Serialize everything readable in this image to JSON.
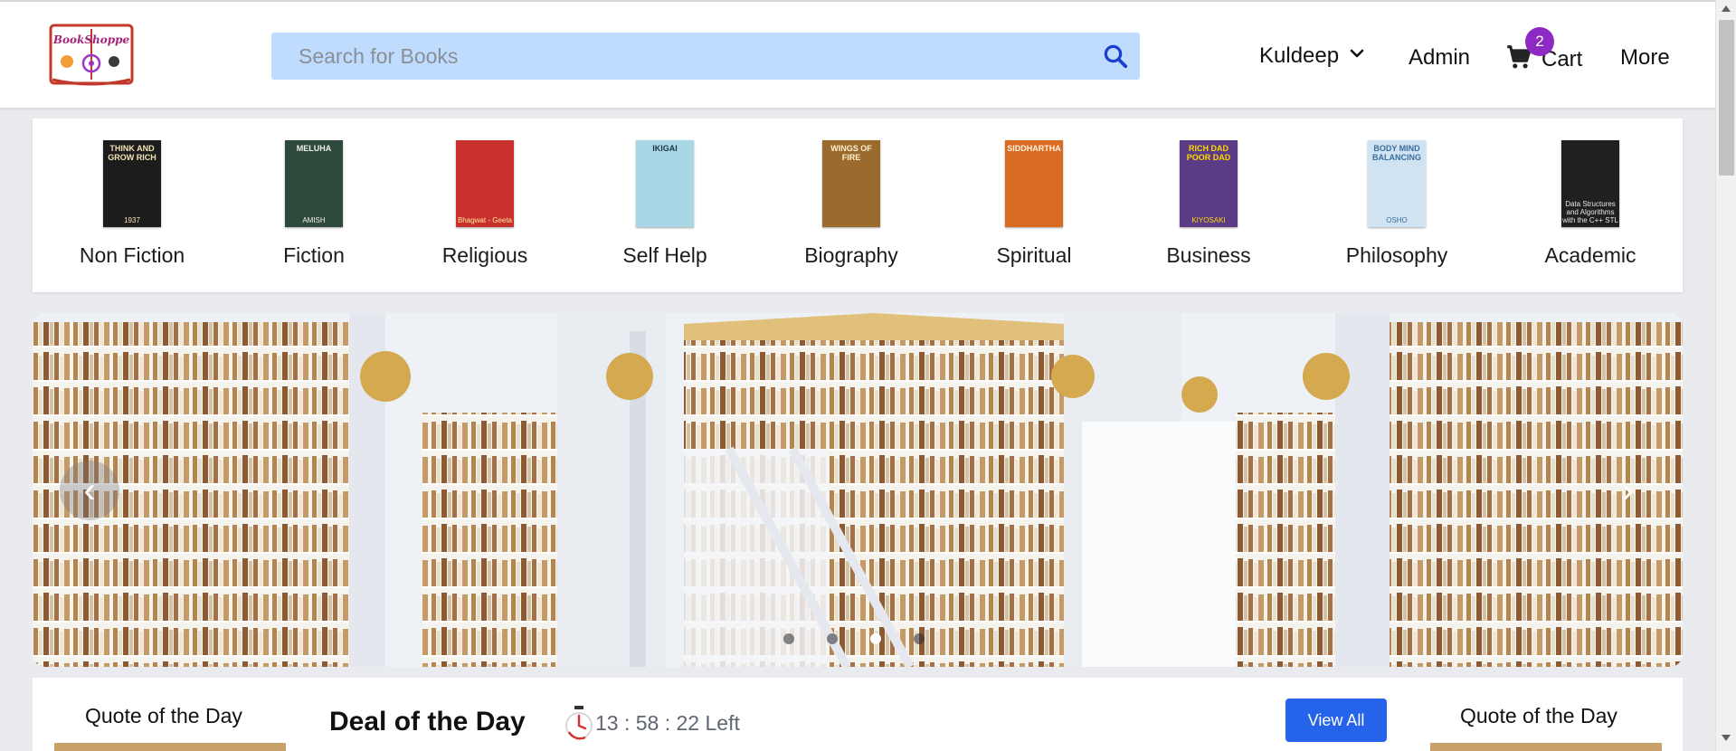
{
  "brand": {
    "logo_text": "BookShoppe"
  },
  "search": {
    "placeholder": "Search for Books",
    "value": ""
  },
  "nav": {
    "user": "Kuldeep",
    "admin": "Admin",
    "cart_label": "Cart",
    "cart_count": "2",
    "more": "More"
  },
  "categories": [
    {
      "label": "Non Fiction",
      "cover_title": "THINK AND GROW RICH",
      "cover_sub": "1937",
      "cover_color": "#1c1c1c",
      "cover_text_color": "#f2e2b5"
    },
    {
      "label": "Fiction",
      "cover_title": "MELUHA",
      "cover_sub": "AMISH",
      "cover_color": "#2e4a3c",
      "cover_text_color": "#f0f0e6"
    },
    {
      "label": "Religious",
      "cover_title": "",
      "cover_sub": "Bhagwat - Geeta",
      "cover_color": "#c8302b",
      "cover_text_color": "#ffe8a0"
    },
    {
      "label": "Self Help",
      "cover_title": "IKIGAI",
      "cover_sub": "",
      "cover_color": "#a8d7e6",
      "cover_text_color": "#1d3440"
    },
    {
      "label": "Biography",
      "cover_title": "WINGS OF FIRE",
      "cover_sub": "",
      "cover_color": "#9b6b2d",
      "cover_text_color": "#fff1cf"
    },
    {
      "label": "Spiritual",
      "cover_title": "SIDDHARTHA",
      "cover_sub": "",
      "cover_color": "#d96c22",
      "cover_text_color": "#fff4e0"
    },
    {
      "label": "Business",
      "cover_title": "RICH DAD POOR DAD",
      "cover_sub": "KIYOSAKI",
      "cover_color": "#5a3b86",
      "cover_text_color": "#ffd800"
    },
    {
      "label": "Philosophy",
      "cover_title": "BODY MIND BALANCING",
      "cover_sub": "OSHO",
      "cover_color": "#cfe3f2",
      "cover_text_color": "#3b6e9c"
    },
    {
      "label": "Academic",
      "cover_title": "",
      "cover_sub": "Data Structures and Algorithms with the C++ STL",
      "cover_color": "#202020",
      "cover_text_color": "#e6e6e6"
    }
  ],
  "carousel": {
    "prev": "‹",
    "next": "›",
    "slide_count": 4,
    "active_index": 2
  },
  "deal": {
    "quote_left": "Quote of the Day",
    "title": "Deal of the Day",
    "timer": "13 : 58 : 22 Left",
    "view_all": "View All",
    "quote_right": "Quote of the Day"
  },
  "colors": {
    "accent": "#2563eb",
    "badge": "#8e2ac3",
    "search_bg": "#bfdbfe"
  }
}
